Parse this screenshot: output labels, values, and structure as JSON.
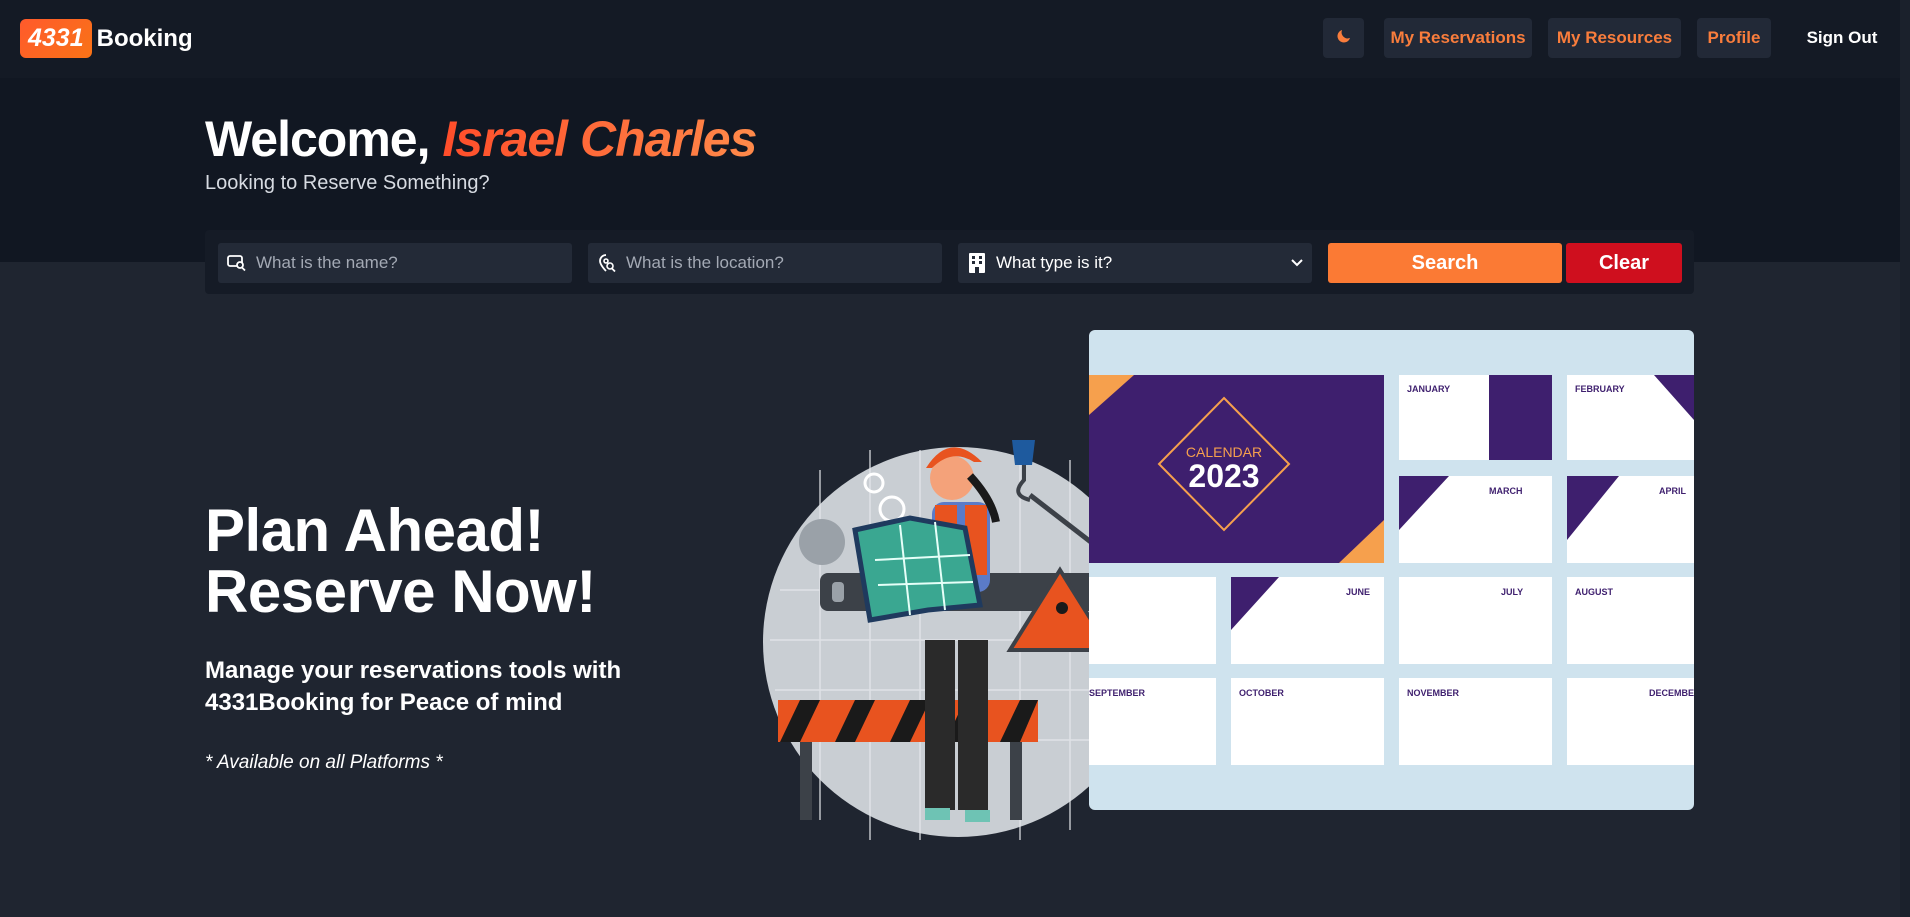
{
  "brand": {
    "badge": "4331",
    "name": "Booking",
    "accent": "#f97316"
  },
  "nav": {
    "theme_icon": "moon-icon",
    "my_reservations": "My Reservations",
    "my_resources": "My Resources",
    "profile": "Profile",
    "sign_out": "Sign Out"
  },
  "welcome": {
    "greeting": "Welcome,",
    "user_name": "Israel Charles",
    "subtitle": "Looking to Reserve Something?"
  },
  "search": {
    "name_placeholder": "What is the name?",
    "location_placeholder": "What is the location?",
    "type_selected": "What type is it?",
    "search_label": "Search",
    "clear_label": "Clear",
    "search_color": "#fb7a34",
    "clear_color": "#cf0f1e"
  },
  "hero": {
    "title_line1": "Plan Ahead!",
    "title_line2": "Reserve Now!",
    "description": "Manage your reservations tools with 4331Booking for Peace of mind",
    "note": "* Available on all Platforms *"
  },
  "calendar_image": {
    "cover_label": "CALENDAR",
    "cover_year": "2023",
    "months": [
      "JANUARY",
      "FEBRUARY",
      "MARCH",
      "APRIL",
      "JUNE",
      "JULY",
      "AUGUST",
      "SEPTEMBER",
      "OCTOBER",
      "NOVEMBER",
      "DECEMBER"
    ]
  }
}
